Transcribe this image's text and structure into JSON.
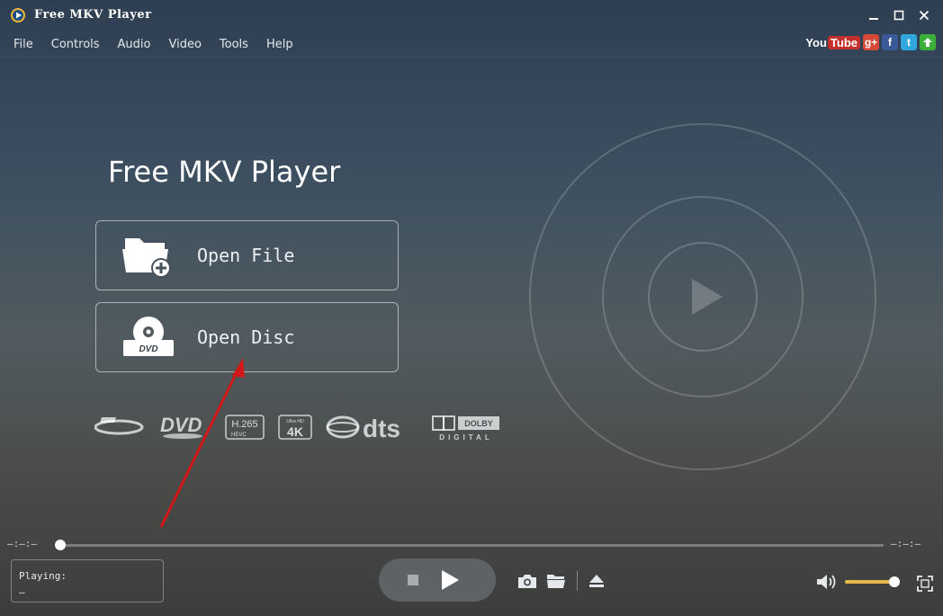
{
  "window": {
    "title": "Free MKV Player"
  },
  "menu": [
    "File",
    "Controls",
    "Audio",
    "Video",
    "Tools",
    "Help"
  ],
  "social": {
    "youtube_you": "You",
    "youtube_tube": "Tube",
    "gplus": "g+",
    "facebook": "f",
    "twitter": "t"
  },
  "hero": {
    "title": "Free MKV Player",
    "open_file": "Open File",
    "open_disc": "Open Disc"
  },
  "formats": {
    "hevc_top": "H.265",
    "hevc_bottom": "HEVC",
    "uhd_top": "Ultra HD",
    "uhd_main": "4K",
    "dts": "dts",
    "dolby_top": "DOLBY",
    "dolby_bottom": "DIGITAL",
    "dvd": "DVD"
  },
  "disc_badge": "DVD",
  "player": {
    "time_elapsed": "—:—:—",
    "time_total": "—:—:—",
    "progress": 0.0,
    "playing_label": "Playing:",
    "playing_value": "—",
    "volume": 0.92
  },
  "colors": {
    "accent_volume": "#e6b84a",
    "arrow": "#d01818"
  }
}
